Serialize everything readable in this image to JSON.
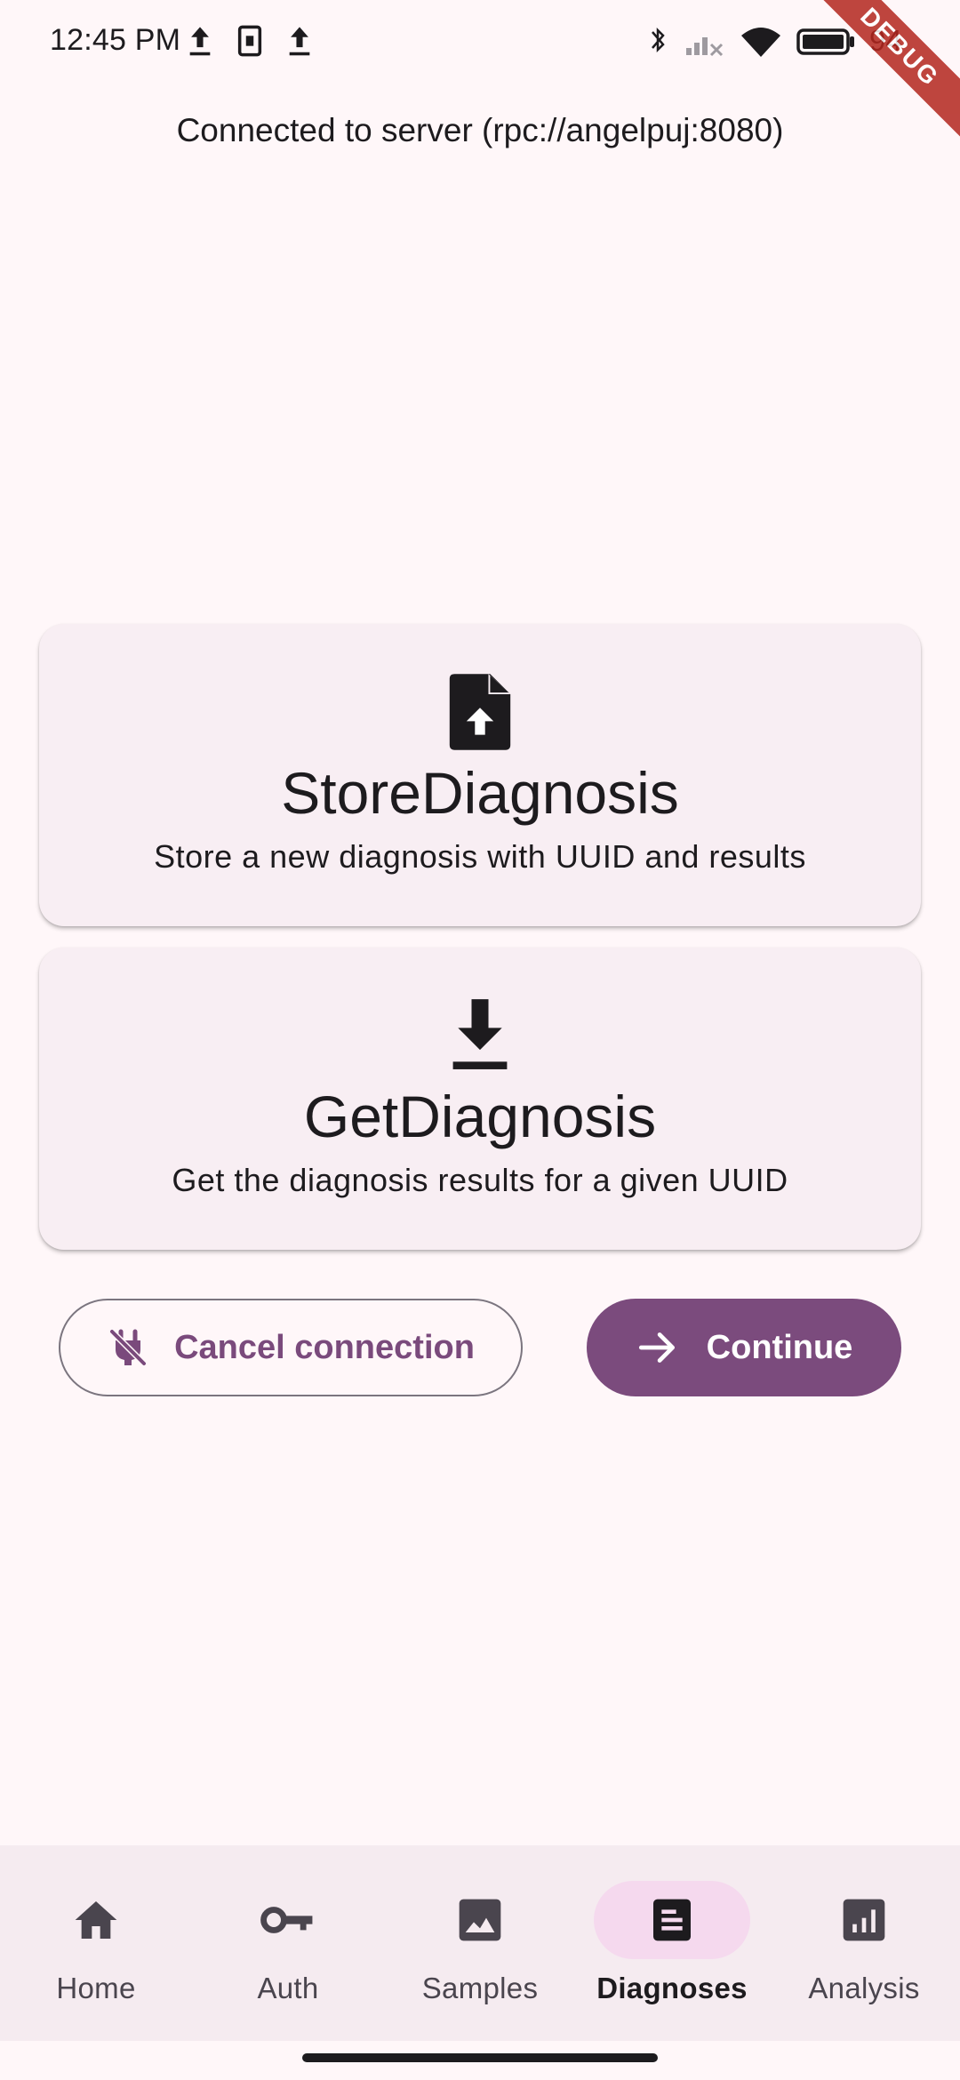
{
  "status_bar": {
    "time": "12:45 PM",
    "battery_percent": "94",
    "debug_banner": "DEBUG"
  },
  "server_status": "Connected to server (rpc://angelpuj:8080)",
  "cards": [
    {
      "icon": "file-upload-icon",
      "title": "StoreDiagnosis",
      "description": "Store a new diagnosis with UUID and results"
    },
    {
      "icon": "download-icon",
      "title": "GetDiagnosis",
      "description": "Get the diagnosis results for a given UUID"
    }
  ],
  "actions": {
    "cancel_label": "Cancel connection",
    "continue_label": "Continue"
  },
  "nav": {
    "items": [
      {
        "label": "Home",
        "icon": "home-icon"
      },
      {
        "label": "Auth",
        "icon": "key-icon"
      },
      {
        "label": "Samples",
        "icon": "image-icon"
      },
      {
        "label": "Diagnoses",
        "icon": "article-icon",
        "active": true
      },
      {
        "label": "Analysis",
        "icon": "analytics-icon"
      }
    ]
  },
  "colors": {
    "background": "#fff7f9",
    "primary": "#7b4b7d",
    "card": "#f8eef3",
    "nav_background": "#f5ebf0",
    "nav_active_indicator": "#f5d9ee"
  }
}
